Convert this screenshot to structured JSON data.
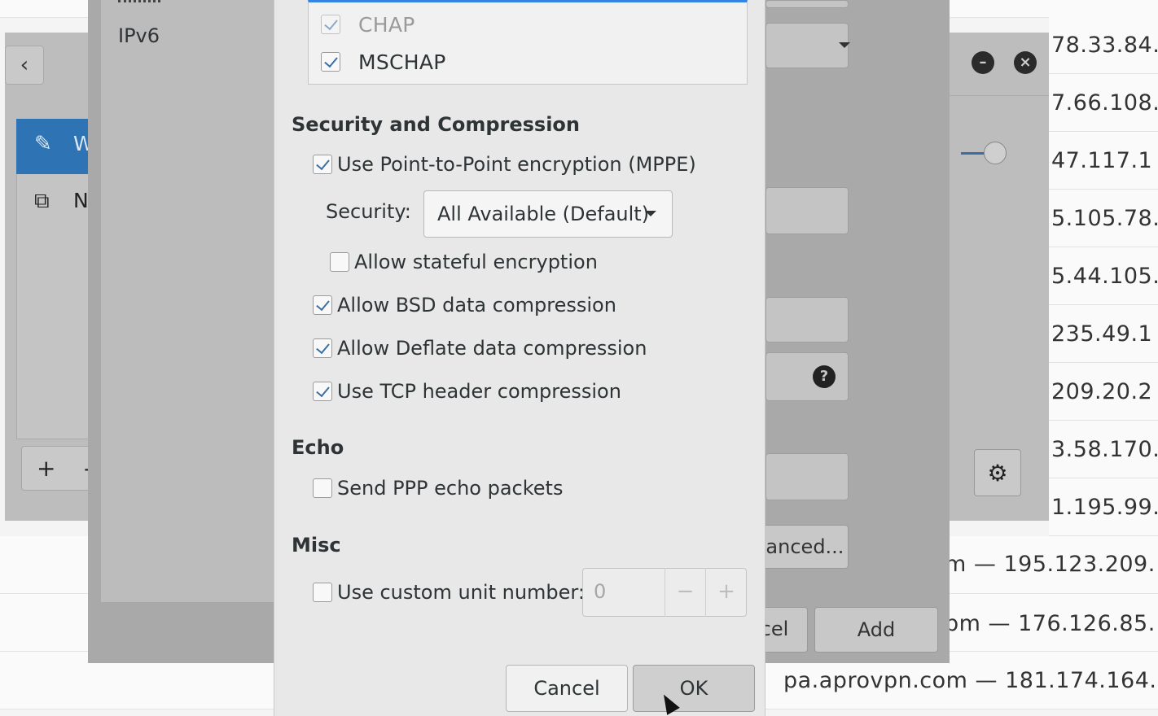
{
  "background_list": {
    "rows": [
      "78.33.84.",
      "7.66.108.",
      "47.117.1",
      "5.105.78.",
      "5.44.105.",
      "235.49.1",
      "209.20.2",
      "3.58.170.",
      "1.195.99.",
      "m — 195.123.209.",
      "pm — 176.126.85.",
      "pa.aprovpn.com — 181.174.164."
    ]
  },
  "network_window": {
    "back_icon": "chevron-left-icon",
    "sidebar_items": [
      {
        "label": "W",
        "icon": "wireless-icon"
      },
      {
        "label": "N",
        "icon": "network-icon"
      }
    ],
    "add_label": "+",
    "remove_label": "-",
    "minimize_symbol": "–",
    "close_symbol": "×"
  },
  "vpn_window": {
    "sidebar_label": "IPv6",
    "advanced_button": "Advanced...",
    "cancel_button": "Cancel",
    "add_button": "Add",
    "help_symbol": "?"
  },
  "ppp_dialog": {
    "auth_methods": [
      {
        "label": "CHAP",
        "checked": true,
        "dimmed": true
      },
      {
        "label": "MSCHAP",
        "checked": true,
        "dimmed": false
      }
    ],
    "security_section": {
      "title": "Security and Compression",
      "use_mppe": "Use Point-to-Point encryption (MPPE)",
      "security_label": "Security:",
      "security_value": "All Available (Default)",
      "stateful": "Allow stateful encryption",
      "bsd": "Allow BSD data compression",
      "deflate": "Allow Deflate data compression",
      "tcp_header": "Use TCP header compression"
    },
    "echo_section": {
      "title": "Echo",
      "send_echo": "Send PPP echo packets"
    },
    "misc_section": {
      "title": "Misc",
      "custom_unit": "Use custom unit number:",
      "unit_value": "0",
      "minus": "−",
      "plus": "+"
    },
    "cancel_button": "Cancel",
    "ok_button": "OK"
  }
}
